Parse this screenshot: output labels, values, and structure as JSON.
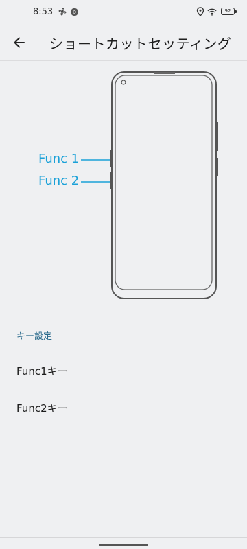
{
  "status_bar": {
    "time": "8:53",
    "battery": "92",
    "icons": [
      "fan-icon",
      "chrome-icon",
      "location-icon",
      "wifi-icon",
      "battery-icon"
    ]
  },
  "app_bar": {
    "title": "ショートカットセッティング",
    "back_icon": "arrow-left-icon"
  },
  "illustration": {
    "callouts": [
      {
        "label": "Func 1"
      },
      {
        "label": "Func 2"
      }
    ],
    "accent_color": "#1aa1d8"
  },
  "settings": {
    "section_header": "キー設定",
    "items": [
      {
        "label": "Func1キー"
      },
      {
        "label": "Func2キー"
      }
    ]
  }
}
